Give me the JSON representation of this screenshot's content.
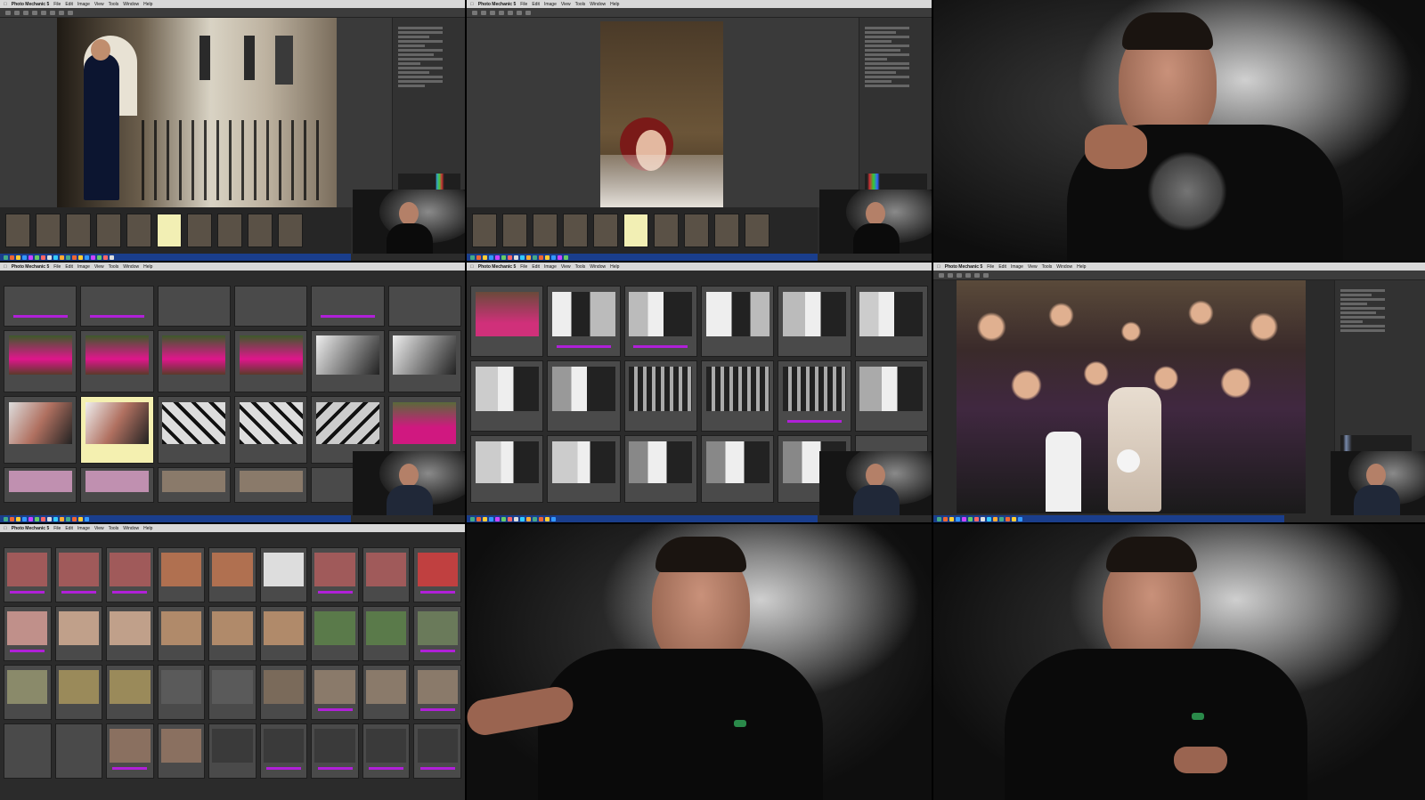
{
  "app": {
    "name": "Photo Mechanic 5",
    "menus": [
      "File",
      "Edit",
      "Image",
      "View",
      "Tools",
      "Window",
      "Help"
    ]
  },
  "tiles": [
    {
      "id": "t1",
      "kind": "preview",
      "subject": "groom-portrait"
    },
    {
      "id": "t2",
      "kind": "preview",
      "subject": "bride-portrait"
    },
    {
      "id": "t3",
      "kind": "presenter"
    },
    {
      "id": "t4",
      "kind": "contact-sheet"
    },
    {
      "id": "t5",
      "kind": "contact-sheet"
    },
    {
      "id": "t6",
      "kind": "preview",
      "subject": "group-photo"
    },
    {
      "id": "t7",
      "kind": "contact-sheet"
    },
    {
      "id": "t8",
      "kind": "presenter"
    },
    {
      "id": "t9",
      "kind": "presenter"
    }
  ],
  "colors": {
    "menubar": "#d8d8d8",
    "app_bg": "#2b2b2b",
    "selection": "#f4f0b0",
    "color_class_tag": "#b020d8",
    "dock": "#1a3e8c",
    "backdrop": "#1a1a1a"
  },
  "icons": [
    "apple-icon",
    "toolbar-icon",
    "histogram-icon",
    "dock-icon"
  ]
}
